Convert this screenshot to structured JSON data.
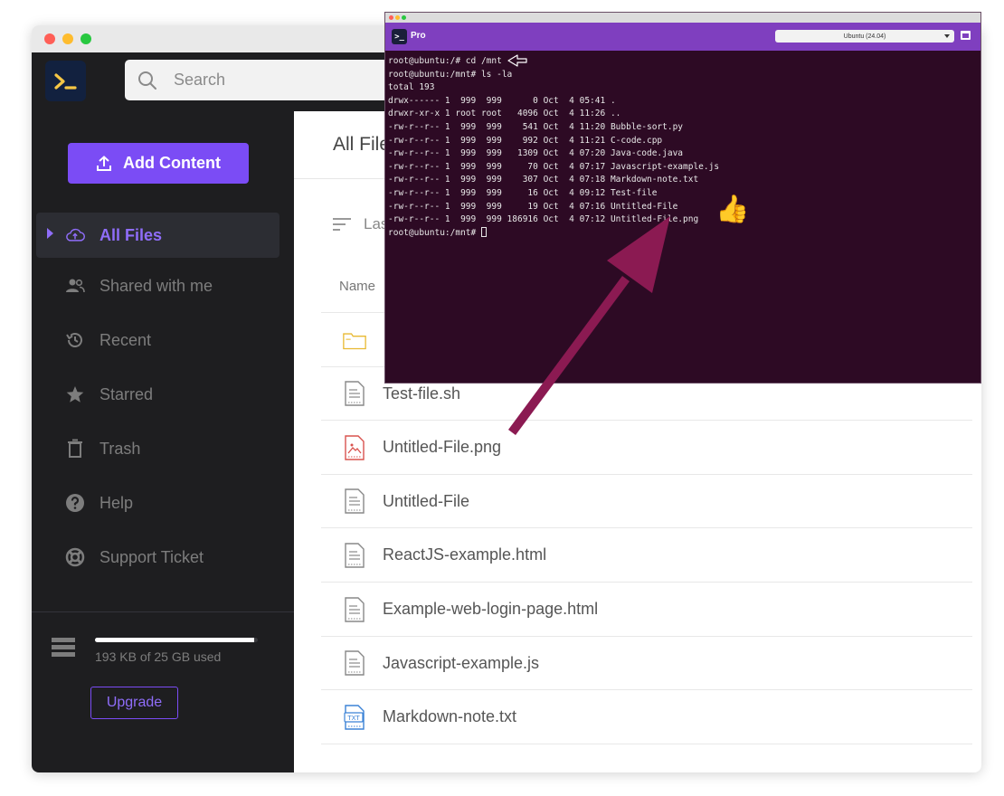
{
  "file_manager": {
    "search": {
      "placeholder": "Search"
    },
    "add_content_label": "Add Content",
    "main_title": "All Files",
    "sort_label": "Last",
    "column_name": "Name",
    "nav": [
      {
        "label": "All Files",
        "icon": "cloud-upload-icon",
        "active": true
      },
      {
        "label": "Shared with me",
        "icon": "people-icon",
        "active": false
      },
      {
        "label": "Recent",
        "icon": "history-icon",
        "active": false
      },
      {
        "label": "Starred",
        "icon": "star-icon",
        "active": false
      },
      {
        "label": "Trash",
        "icon": "trash-icon",
        "active": false
      },
      {
        "label": "Help",
        "icon": "help-icon",
        "active": false
      },
      {
        "label": "Support Ticket",
        "icon": "lifebuoy-icon",
        "active": false
      }
    ],
    "storage": {
      "used_text": "193 KB of 25 GB used",
      "used_fraction": 0.98
    },
    "upgrade_label": "Upgrade",
    "files": [
      {
        "name": "",
        "type": "folder"
      },
      {
        "name": "Test-file.sh",
        "type": "document"
      },
      {
        "name": "Untitled-File.png",
        "type": "image"
      },
      {
        "name": "Untitled-File",
        "type": "document"
      },
      {
        "name": "ReactJS-example.html",
        "type": "document"
      },
      {
        "name": "Example-web-login-page.html",
        "type": "document"
      },
      {
        "name": "Javascript-example.js",
        "type": "document"
      },
      {
        "name": "Markdown-note.txt",
        "type": "txt"
      }
    ]
  },
  "terminal": {
    "product_label": "Pro",
    "distro_select": "Ubuntu (24.04)",
    "lines": [
      "root@ubuntu:/# cd /mnt",
      "root@ubuntu:/mnt# ls -la",
      "total 193",
      "drwx------ 1  999  999      0 Oct  4 05:41 .",
      "drwxr-xr-x 1 root root   4096 Oct  4 11:26 ..",
      "-rw-r--r-- 1  999  999    541 Oct  4 11:20 Bubble-sort.py",
      "-rw-r--r-- 1  999  999    992 Oct  4 11:21 C-code.cpp",
      "-rw-r--r-- 1  999  999   1309 Oct  4 07:20 Java-code.java",
      "-rw-r--r-- 1  999  999     70 Oct  4 07:17 Javascript-example.js",
      "-rw-r--r-- 1  999  999    307 Oct  4 07:18 Markdown-note.txt",
      "-rw-r--r-- 1  999  999     16 Oct  4 09:12 Test-file",
      "-rw-r--r-- 1  999  999     19 Oct  4 07:16 Untitled-File",
      "-rw-r--r-- 1  999  999 186916 Oct  4 07:12 Untitled-File.png",
      "root@ubuntu:/mnt# "
    ]
  },
  "annotations": {
    "thumbs_up_emoji": "👍",
    "arrow_color": "#8b1a52",
    "pointer_arrow_color": "#ffffff"
  },
  "colors": {
    "accent": "#7b4cf5",
    "sidebar_bg": "#1e1e20",
    "terminal_bg": "#2d0a24",
    "terminal_toolbar": "#7f3fbf"
  }
}
